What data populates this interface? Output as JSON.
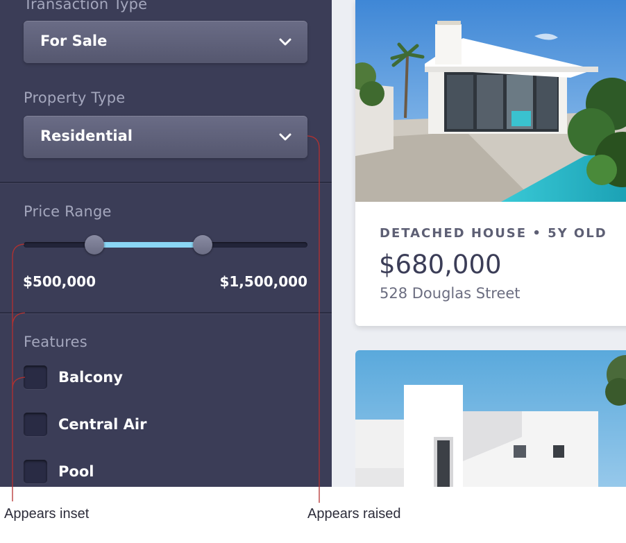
{
  "filters": {
    "transaction_type": {
      "label": "Transaction Type",
      "value": "For Sale"
    },
    "property_type": {
      "label": "Property Type",
      "value": "Residential"
    },
    "price_range": {
      "label": "Price Range",
      "min": "$500,000",
      "max": "$1,500,000",
      "low_fraction": 0.25,
      "high_fraction": 0.63,
      "fill_color": "#8ad6f4"
    },
    "features": {
      "label": "Features",
      "items": [
        {
          "label": "Balcony",
          "checked": false
        },
        {
          "label": "Central Air",
          "checked": false
        },
        {
          "label": "Pool",
          "checked": false
        }
      ]
    }
  },
  "listings": [
    {
      "meta": "DETACHED HOUSE • 5Y OLD",
      "price": "$680,000",
      "address": "528 Douglas Street"
    }
  ],
  "annotations": {
    "inset": "Appears inset",
    "raised": "Appears raised",
    "line_color": "#b5312f"
  },
  "colors": {
    "sidebar": "#3b3d57",
    "page": "#eceef3",
    "accent": "#8ad6f4"
  },
  "icons": {
    "dropdown": "chevron-down-icon"
  }
}
